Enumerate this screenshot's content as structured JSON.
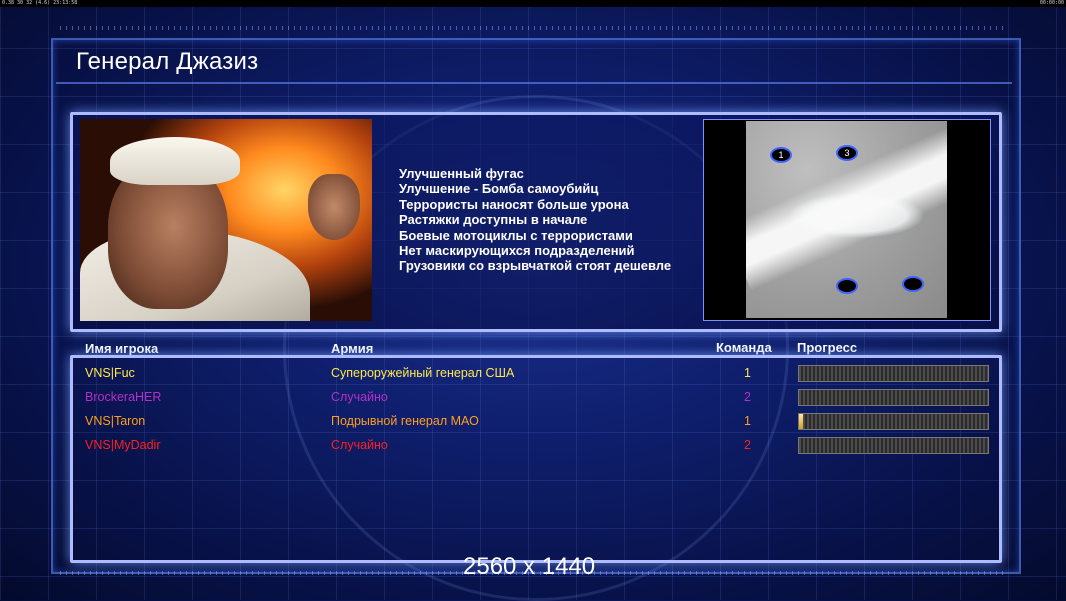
{
  "status_bar": {
    "left_text": "0.38 30 32 (4.6)   23:13:58",
    "right_text": "00:00:00"
  },
  "screen": {
    "title": "Генерал Джазиз"
  },
  "general_bonuses": [
    "Улучшенный фугас",
    "Улучшение - Бомба самоубийц",
    "Террористы наносят больше урона",
    "Растяжки доступны в начале",
    "Боевые мотоциклы с террористами",
    "Нет маскирующихся подразделений",
    "Грузовики со взрывчаткой стоят дешевле"
  ],
  "minimap": {
    "start_labels": [
      "1",
      "3"
    ]
  },
  "table": {
    "headers": {
      "name": "Имя игрока",
      "army": "Армия",
      "team": "Команда",
      "progress": "Прогресс"
    },
    "rows": [
      {
        "name": "VNS|Fuc",
        "army": "Супероружейный генерал США",
        "team": "1",
        "color": "#ffe84d",
        "progress": 0
      },
      {
        "name": "BrockeraHER",
        "army": "Случайно",
        "team": "2",
        "color": "#b530c7",
        "progress": 0
      },
      {
        "name": "VNS|Taron",
        "army": "Подрывной генерал МАО",
        "team": "1",
        "color": "#ff9e1f",
        "progress": 0.02
      },
      {
        "name": "VNS|MyDadir",
        "army": "Случайно",
        "team": "2",
        "color": "#ff1f1f",
        "progress": 0
      }
    ]
  },
  "resolution_text": "2560 x 1440",
  "colors": {
    "accent": "#aebcff",
    "background": "#0f1f6e"
  }
}
